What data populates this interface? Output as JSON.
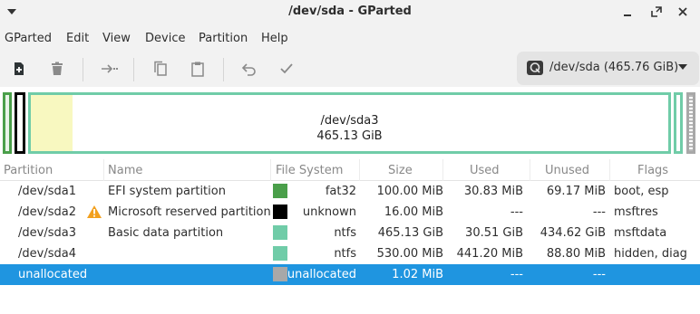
{
  "window": {
    "title": "/dev/sda - GParted"
  },
  "menubar": {
    "items": [
      "GParted",
      "Edit",
      "View",
      "Device",
      "Partition",
      "Help"
    ]
  },
  "toolbar": {
    "icons": [
      "new-partition-icon",
      "delete-icon",
      "resize-move-icon",
      "copy-icon",
      "paste-icon",
      "undo-icon",
      "apply-icon"
    ]
  },
  "device_selector": {
    "label": "/dev/sda (465.76 GiB)"
  },
  "disk_map": {
    "selected_name": "/dev/sda3",
    "selected_size": "465.13 GiB",
    "sda3_used_fraction": 0.066
  },
  "table": {
    "headers": [
      "Partition",
      "Name",
      "File System",
      "Size",
      "Used",
      "Unused",
      "Flags"
    ],
    "rows": [
      {
        "partition": "/dev/sda1",
        "name": "EFI system partition",
        "fs": "fat32",
        "fs_color": "#4a9f4a",
        "size": "100.00 MiB",
        "used": "30.83 MiB",
        "unused": "69.17 MiB",
        "flags": "boot, esp",
        "warning": false,
        "selected": false
      },
      {
        "partition": "/dev/sda2",
        "name": "Microsoft reserved partition",
        "fs": "unknown",
        "fs_color": "#000000",
        "size": "16.00 MiB",
        "used": "---",
        "unused": "---",
        "flags": "msftres",
        "warning": true,
        "selected": false
      },
      {
        "partition": "/dev/sda3",
        "name": "Basic data partition",
        "fs": "ntfs",
        "fs_color": "#70cca8",
        "size": "465.13 GiB",
        "used": "30.51 GiB",
        "unused": "434.62 GiB",
        "flags": "msftdata",
        "warning": false,
        "selected": false
      },
      {
        "partition": "/dev/sda4",
        "name": "",
        "fs": "ntfs",
        "fs_color": "#70cca8",
        "size": "530.00 MiB",
        "used": "441.20 MiB",
        "unused": "88.80 MiB",
        "flags": "hidden, diag",
        "warning": false,
        "selected": false
      },
      {
        "partition": "unallocated",
        "name": "",
        "fs": "unallocated",
        "fs_color": "#a8a8a8",
        "size": "1.02 MiB",
        "used": "---",
        "unused": "---",
        "flags": "",
        "warning": false,
        "selected": true
      }
    ]
  },
  "colors": {
    "selection": "#1f95e0",
    "fat32": "#4a9f4a",
    "ntfs": "#70cca8",
    "used_space": "#f8f8c0"
  }
}
